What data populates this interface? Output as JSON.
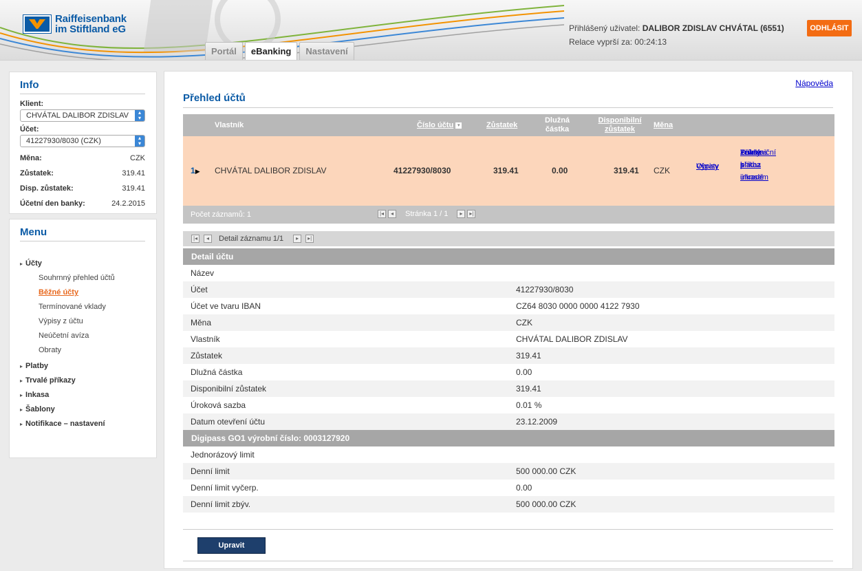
{
  "header": {
    "logo_line1": "Raiffeisenbank",
    "logo_line2": "im Stiftland eG",
    "tabs": [
      {
        "label": "Portál"
      },
      {
        "label": "eBanking"
      },
      {
        "label": "Nastavení"
      }
    ],
    "user_label": "Přihlášený uživatel:",
    "user_name": "DALIBOR ZDISLAV CHVÁTAL (6551)",
    "session_label": "Relace vyprší za:",
    "session_time": "00:24:13",
    "logout_label": "ODHLÁSIT"
  },
  "info": {
    "title": "Info",
    "client_label": "Klient:",
    "client_value": "CHVÁTAL DALIBOR ZDISLAV",
    "account_label": "Účet:",
    "account_value": "41227930/8030 (CZK)",
    "rows": [
      {
        "label": "Měna:",
        "value": "CZK"
      },
      {
        "label": "Zůstatek:",
        "value": "319.41"
      },
      {
        "label": "Disp. zůstatek:",
        "value": "319.41"
      },
      {
        "label": "Účetní den banky:",
        "value": "24.2.2015"
      }
    ]
  },
  "menu": {
    "title": "Menu",
    "items": [
      {
        "label": "Účty"
      },
      {
        "label": "Souhrnný přehled účtů"
      },
      {
        "label": "Běžné účty"
      },
      {
        "label": "Termínované vklady"
      },
      {
        "label": "Výpisy z účtu"
      },
      {
        "label": "Neúčetní avíza"
      },
      {
        "label": "Obraty"
      },
      {
        "label": "Platby"
      },
      {
        "label": "Trvalé příkazy"
      },
      {
        "label": "Inkasa"
      },
      {
        "label": "Šablony"
      },
      {
        "label": "Notifikace – nastavení"
      }
    ]
  },
  "main": {
    "help": "Nápověda",
    "title": "Přehled účtů",
    "table": {
      "headers": {
        "owner": "Vlastník",
        "number": "Číslo účtu",
        "balance": "Zůstatek",
        "debt1": "Dlužná",
        "debt2": "částka",
        "avail1": "Disponibilní",
        "avail2": "zůstatek",
        "currency": "Měna"
      },
      "row": {
        "index": "1",
        "owner": "CHVÁTAL DALIBOR ZDISLAV",
        "number": "41227930/8030",
        "balance": "319.41",
        "debt": "0.00",
        "available": "319.41",
        "currency": "CZK",
        "links_a": [
          "Obraty",
          "Výpisy"
        ],
        "links_b": [
          "Příkaz k úhradě",
          "Zahraniční platba",
          "Trvalý příkaz",
          "Souhlas s inkasem"
        ]
      },
      "footer_count": "Počet záznamů: 1",
      "footer_page": "Stránka 1 / 1"
    },
    "detail_nav": "Detail záznamu 1/1",
    "detail_title": "Detail účtu",
    "detail_rows": [
      {
        "label": "Název",
        "value": ""
      },
      {
        "label": "Účet",
        "value": "41227930/8030"
      },
      {
        "label": "Účet ve tvaru IBAN",
        "value": "CZ64 8030 0000 0000 4122 7930"
      },
      {
        "label": "Měna",
        "value": "CZK"
      },
      {
        "label": "Vlastník",
        "value": "CHVÁTAL DALIBOR ZDISLAV"
      },
      {
        "label": "Zůstatek",
        "value": "319.41"
      },
      {
        "label": "Dlužná částka",
        "value": "0.00"
      },
      {
        "label": "Disponibilní zůstatek",
        "value": "319.41"
      },
      {
        "label": "Úroková sazba",
        "value": "0.01 %"
      },
      {
        "label": "Datum otevření účtu",
        "value": "23.12.2009"
      }
    ],
    "digipass_title": "Digipass GO1 výrobní číslo: 0003127920",
    "digipass_rows": [
      {
        "label": "Jednorázový limit",
        "value": ""
      },
      {
        "label": "Denní limit",
        "value": "500 000.00 CZK"
      },
      {
        "label": "Denní limit vyčerp.",
        "value": "0.00"
      },
      {
        "label": "Denní limit zbýv.",
        "value": "500 000.00 CZK"
      },
      {
        "label": "",
        "value": ""
      }
    ],
    "edit_button": "Upravit"
  }
}
